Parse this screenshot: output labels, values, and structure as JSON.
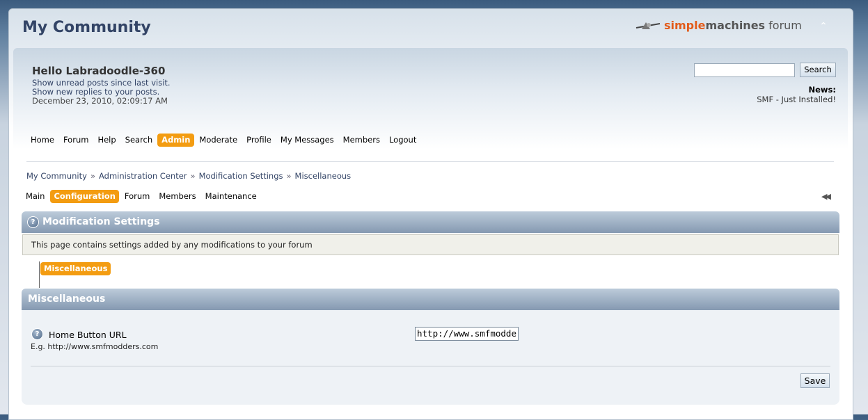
{
  "site": {
    "title": "My Community",
    "logo": {
      "simple": "simple",
      "machines": "machines",
      "forum": "forum"
    },
    "collapse_icon": "chevron-up-icon"
  },
  "user": {
    "greeting": "Hello Labradoodle-360",
    "link_unread": "Show unread posts since last visit.",
    "link_replies": "Show new replies to your posts.",
    "datetime": "December 23, 2010, 02:09:17 AM"
  },
  "search": {
    "value": "",
    "button_label": "Search"
  },
  "news": {
    "label": "News:",
    "text": "SMF - Just Installed!"
  },
  "menu": {
    "items": [
      {
        "label": "Home",
        "active": false
      },
      {
        "label": "Forum",
        "active": false
      },
      {
        "label": "Help",
        "active": false
      },
      {
        "label": "Search",
        "active": false
      },
      {
        "label": "Admin",
        "active": true
      },
      {
        "label": "Moderate",
        "active": false
      },
      {
        "label": "Profile",
        "active": false
      },
      {
        "label": "My Messages",
        "active": false
      },
      {
        "label": "Members",
        "active": false
      },
      {
        "label": "Logout",
        "active": false
      }
    ]
  },
  "breadcrumb": [
    "My Community",
    "Administration Center",
    "Modification Settings",
    "Miscellaneous"
  ],
  "breadcrumb_sep": "»",
  "admin_menu": {
    "items": [
      {
        "label": "Main",
        "active": false
      },
      {
        "label": "Configuration",
        "active": true
      },
      {
        "label": "Forum",
        "active": false
      },
      {
        "label": "Members",
        "active": false
      },
      {
        "label": "Maintenance",
        "active": false
      }
    ],
    "collapse_icon": "rewind-icon"
  },
  "section": {
    "title": "Modification Settings",
    "description": "This page contains settings added by any modifications to your forum",
    "tab": "Miscellaneous"
  },
  "misc": {
    "title": "Miscellaneous",
    "setting_label": "Home Button URL",
    "setting_sub": "E.g. http://www.smfmodders.com",
    "setting_value": "http://www.smfmodders.com",
    "save_label": "Save"
  },
  "colors": {
    "accent": "#f39c11",
    "title": "#334466",
    "bar": "#8599b1"
  }
}
